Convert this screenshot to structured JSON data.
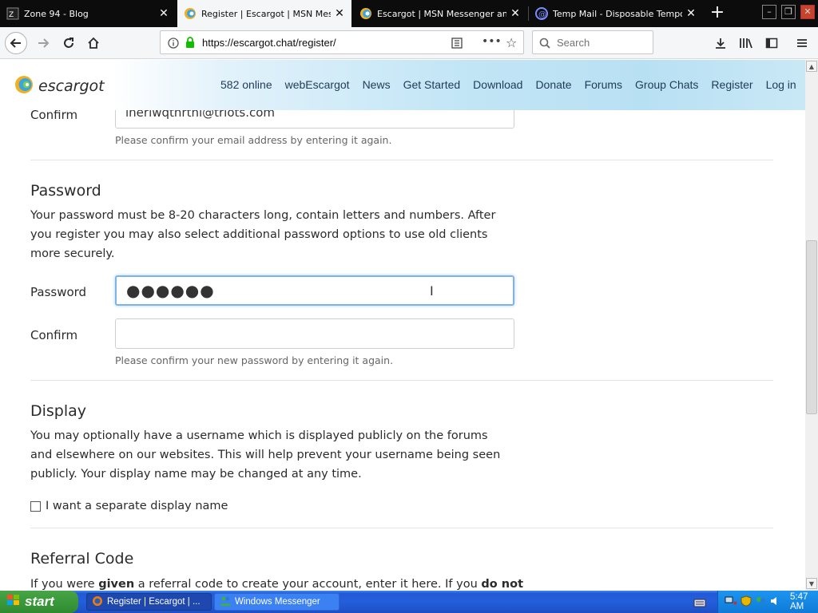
{
  "browser": {
    "tabs": [
      {
        "title": "Zone 94 - Blog",
        "active": false
      },
      {
        "title": "Register | Escargot | MSN Messenger",
        "active": true
      },
      {
        "title": "Escargot | MSN Messenger and Windows Live Messenger",
        "active": false
      },
      {
        "title": "Temp Mail - Disposable Temporary Email",
        "active": false
      }
    ],
    "url": "https://escargot.chat/register/",
    "search_placeholder": "Search"
  },
  "site": {
    "logo_text": "escargot",
    "nav": [
      "582 online",
      "webEscargot",
      "News",
      "Get Started",
      "Download",
      "Donate",
      "Forums",
      "Group Chats",
      "Register",
      "Log in"
    ]
  },
  "form": {
    "email_confirm": {
      "label": "Confirm",
      "value": "inerlwqtnrthl@triots.com",
      "help": "Please confirm your email address by entering it again."
    },
    "password_section": {
      "heading": "Password",
      "description": "Your password must be 8-20 characters long, contain letters and numbers. After you register you may also select additional password options to use old clients more securely.",
      "password_label": "Password",
      "password_masked": "●●●●●●",
      "confirm_label": "Confirm",
      "confirm_value": "",
      "confirm_help": "Please confirm your new password by entering it again."
    },
    "display_section": {
      "heading": "Display",
      "description": "You may optionally have a username which is displayed publicly on the forums and elsewhere on our websites. This will help prevent your username being seen publicly. Your display name may be changed at any time.",
      "checkbox_label": "I want a separate display name",
      "checked": false
    },
    "referral_section": {
      "heading": "Referral Code",
      "text_a": "If you were ",
      "text_b": "given",
      "text_c": " a referral code to create your account, enter it here. If you ",
      "text_d": "do not"
    }
  },
  "taskbar": {
    "start_label": "start",
    "tasks": [
      {
        "label": "Register | Escargot | ...",
        "active": true
      },
      {
        "label": "Windows Messenger",
        "active": false
      }
    ],
    "clock": "5:47 AM"
  },
  "colors": {
    "link": "#1f3b57",
    "focus_ring": "#7fb3e6",
    "taskbar_blue": "#245edb",
    "start_green": "#3c9a3c"
  }
}
